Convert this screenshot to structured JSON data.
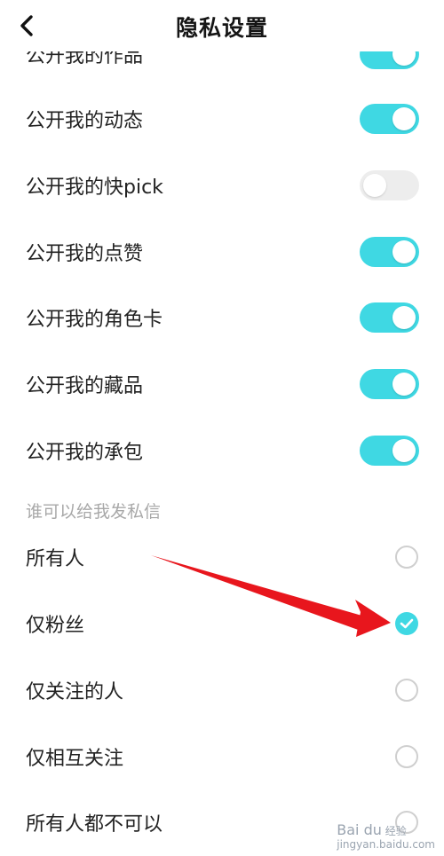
{
  "header": {
    "title": "隐私设置",
    "back_icon": "back-arrow-icon"
  },
  "toggles": [
    {
      "label": "公开我的作品",
      "on": true
    },
    {
      "label": "公开我的动态",
      "on": true
    },
    {
      "label": "公开我的快pick",
      "on": false
    },
    {
      "label": "公开我的点赞",
      "on": true
    },
    {
      "label": "公开我的角色卡",
      "on": true
    },
    {
      "label": "公开我的藏品",
      "on": true
    },
    {
      "label": "公开我的承包",
      "on": true
    }
  ],
  "message_section": {
    "title": "谁可以给我发私信",
    "options": [
      {
        "label": "所有人",
        "checked": false
      },
      {
        "label": "仅粉丝",
        "checked": true
      },
      {
        "label": "仅关注的人",
        "checked": false
      },
      {
        "label": "仅相互关注",
        "checked": false
      },
      {
        "label": "所有人都不可以",
        "checked": false
      }
    ]
  },
  "colors": {
    "accent": "#3fd8e3",
    "arrow": "#e8161d",
    "section_label": "#a8a8a8"
  },
  "watermark": {
    "logo": "Bai du",
    "text": "经验",
    "url": "jingyan.baidu.com"
  }
}
